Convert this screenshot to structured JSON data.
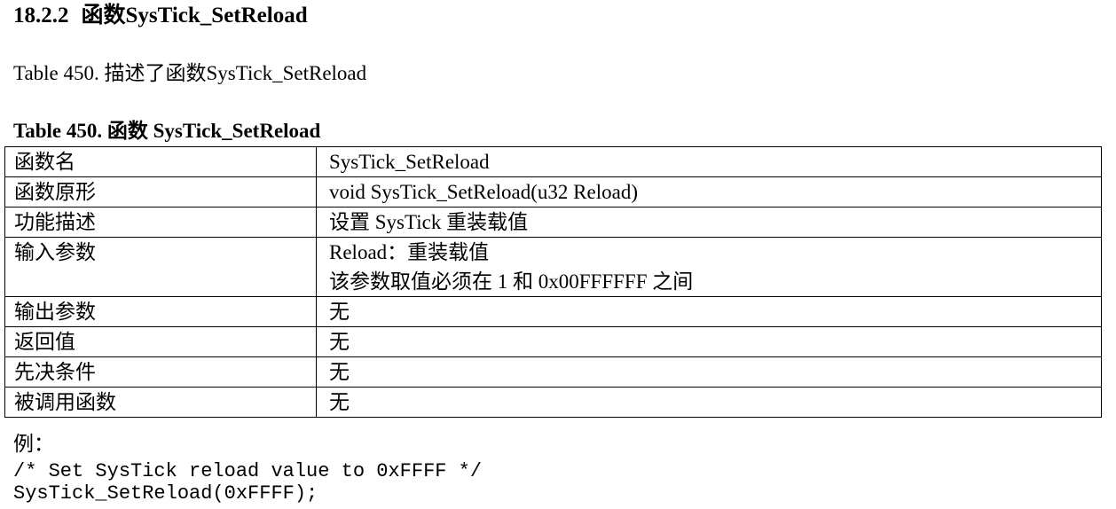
{
  "section": {
    "number": "18.2.2",
    "title": "函数SysTick_SetReload"
  },
  "intro": "Table 450. 描述了函数SysTick_SetReload",
  "caption": "Table 450. 函数 SysTick_SetReload",
  "table": {
    "rows": [
      {
        "label": "函数名",
        "value": [
          "SysTick_SetReload"
        ]
      },
      {
        "label": "函数原形",
        "value": [
          "void SysTick_SetReload(u32 Reload)"
        ]
      },
      {
        "label": "功能描述",
        "value": [
          "设置 SysTick 重装载值"
        ]
      },
      {
        "label": "输入参数",
        "value": [
          "Reload：重装载值",
          "该参数取值必须在 1 和 0x00FFFFFF 之间"
        ]
      },
      {
        "label": "输出参数",
        "value": [
          "无"
        ]
      },
      {
        "label": "返回值",
        "value": [
          "无"
        ]
      },
      {
        "label": "先决条件",
        "value": [
          "无"
        ]
      },
      {
        "label": "被调用函数",
        "value": [
          "无"
        ]
      }
    ]
  },
  "example": {
    "label": "例：",
    "code": [
      "/* Set SysTick reload value to 0xFFFF */",
      "SysTick_SetReload(0xFFFF);"
    ]
  }
}
